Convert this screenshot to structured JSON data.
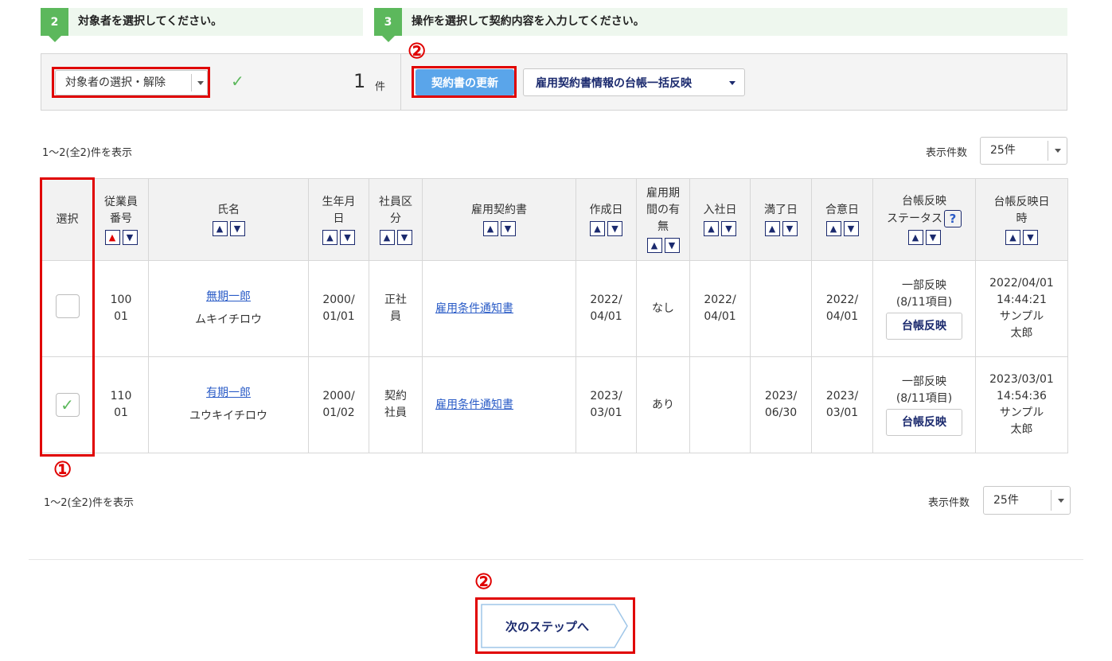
{
  "steps": [
    {
      "num": "2",
      "label": "対象者を選択してください。"
    },
    {
      "num": "3",
      "label": "操作を選択して契約内容を入力してください。"
    }
  ],
  "panel": {
    "select_label": "対象者の選択・解除",
    "check_mark": "✓",
    "count": "1",
    "count_unit": "件",
    "update_button": "契約書の更新",
    "bulk_button": "雇用契約書情報の台帳一括反映"
  },
  "markers": {
    "one": "①",
    "two": "②"
  },
  "pager_top": {
    "summary": "1～2(全2)件を表示",
    "per_page_label": "表示件数",
    "per_page_value": "25件"
  },
  "pager_bottom": {
    "summary": "1～2(全2)件を表示",
    "per_page_label": "表示件数",
    "per_page_value": "25件"
  },
  "table": {
    "headers": {
      "select": "選択",
      "emp_no_1": "従業員",
      "emp_no_2": "番号",
      "name": "氏名",
      "birth_1": "生年月",
      "birth_2": "日",
      "type_1": "社員区",
      "type_2": "分",
      "contract": "雇用契約書",
      "created": "作成日",
      "period_1": "雇用期",
      "period_2": "間の有",
      "period_3": "無",
      "joined": "入社日",
      "expiry": "満了日",
      "agreed": "合意日",
      "status_1": "台帳反映",
      "status_2": "ステータス",
      "help": "?",
      "reflected_1": "台帳反映日",
      "reflected_2": "時"
    },
    "sort_up": "^",
    "sort_down": "v",
    "rows": [
      {
        "checked": "",
        "emp_no_1": "100",
        "emp_no_2": "01",
        "name_link": "無期一郎",
        "name_kana": "ムキイチロウ",
        "birth_1": "2000/",
        "birth_2": "01/01",
        "type_1": "正社",
        "type_2": "員",
        "contract": "雇用条件通知書",
        "created_1": "2022/",
        "created_2": "04/01",
        "period": "なし",
        "joined_1": "2022/",
        "joined_2": "04/01",
        "expiry_1": "",
        "expiry_2": "",
        "agreed_1": "2022/",
        "agreed_2": "04/01",
        "status_1": "一部反映",
        "status_2": "(8/11項目)",
        "reflect_button": "台帳反映",
        "reflected_1": "2022/04/01",
        "reflected_2": "14:44:21",
        "reflected_3": "サンプル",
        "reflected_4": "太郎"
      },
      {
        "checked": "✓",
        "emp_no_1": "110",
        "emp_no_2": "01",
        "name_link": "有期一郎",
        "name_kana": "ユウキイチロウ",
        "birth_1": "2000/",
        "birth_2": "01/02",
        "type_1": "契約",
        "type_2": "社員",
        "contract": "雇用条件通知書",
        "created_1": "2023/",
        "created_2": "03/01",
        "period": "あり",
        "joined_1": "",
        "joined_2": "",
        "expiry_1": "2023/",
        "expiry_2": "06/30",
        "agreed_1": "2023/",
        "agreed_2": "03/01",
        "status_1": "一部反映",
        "status_2": "(8/11項目)",
        "reflect_button": "台帳反映",
        "reflected_1": "2023/03/01",
        "reflected_2": "14:54:36",
        "reflected_3": "サンプル",
        "reflected_4": "太郎"
      }
    ]
  },
  "next_button": "次のステップへ",
  "colors": {
    "accent_blue": "#5aa5ea",
    "step_green": "#5cb85c",
    "highlight_red": "#e00000",
    "navy": "#1b2a6e"
  }
}
